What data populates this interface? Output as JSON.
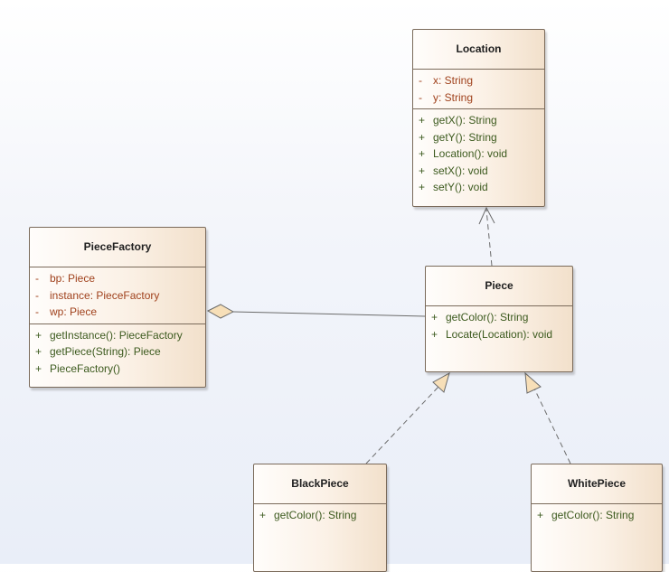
{
  "classes": {
    "location": {
      "name": "Location",
      "attributes": [
        {
          "visibility": "-",
          "text": "x: String"
        },
        {
          "visibility": "-",
          "text": "y: String"
        }
      ],
      "operations": [
        {
          "visibility": "+",
          "text": "getX(): String"
        },
        {
          "visibility": "+",
          "text": "getY(): String"
        },
        {
          "visibility": "+",
          "text": "Location(): void"
        },
        {
          "visibility": "+",
          "text": "setX(): void"
        },
        {
          "visibility": "+",
          "text": "setY(): void"
        }
      ]
    },
    "piece_factory": {
      "name": "PieceFactory",
      "attributes": [
        {
          "visibility": "-",
          "text": "bp: Piece"
        },
        {
          "visibility": "-",
          "text": "instance: PieceFactory"
        },
        {
          "visibility": "-",
          "text": "wp: Piece"
        }
      ],
      "operations": [
        {
          "visibility": "+",
          "text": "getInstance(): PieceFactory"
        },
        {
          "visibility": "+",
          "text": "getPiece(String): Piece"
        },
        {
          "visibility": "+",
          "text": "PieceFactory()"
        }
      ]
    },
    "piece": {
      "name": "Piece",
      "operations": [
        {
          "visibility": "+",
          "text": "getColor(): String"
        },
        {
          "visibility": "+",
          "text": "Locate(Location): void"
        }
      ]
    },
    "black_piece": {
      "name": "BlackPiece",
      "operations": [
        {
          "visibility": "+",
          "text": "getColor(): String"
        }
      ]
    },
    "white_piece": {
      "name": "WhitePiece",
      "operations": [
        {
          "visibility": "+",
          "text": "getColor(): String"
        }
      ]
    }
  },
  "relationships": [
    {
      "kind": "dependency",
      "from": "Piece",
      "to": "Location"
    },
    {
      "kind": "aggregation",
      "from": "PieceFactory",
      "to": "Piece"
    },
    {
      "kind": "realization",
      "from": "BlackPiece",
      "to": "Piece"
    },
    {
      "kind": "realization",
      "from": "WhitePiece",
      "to": "Piece"
    }
  ],
  "colors": {
    "attribute_text": "#a0421d",
    "operation_text": "#3c5a1e",
    "class_border": "#7a6a5a",
    "connector": "#6b6b6b",
    "arrow_fill": "#f7dfb8"
  }
}
